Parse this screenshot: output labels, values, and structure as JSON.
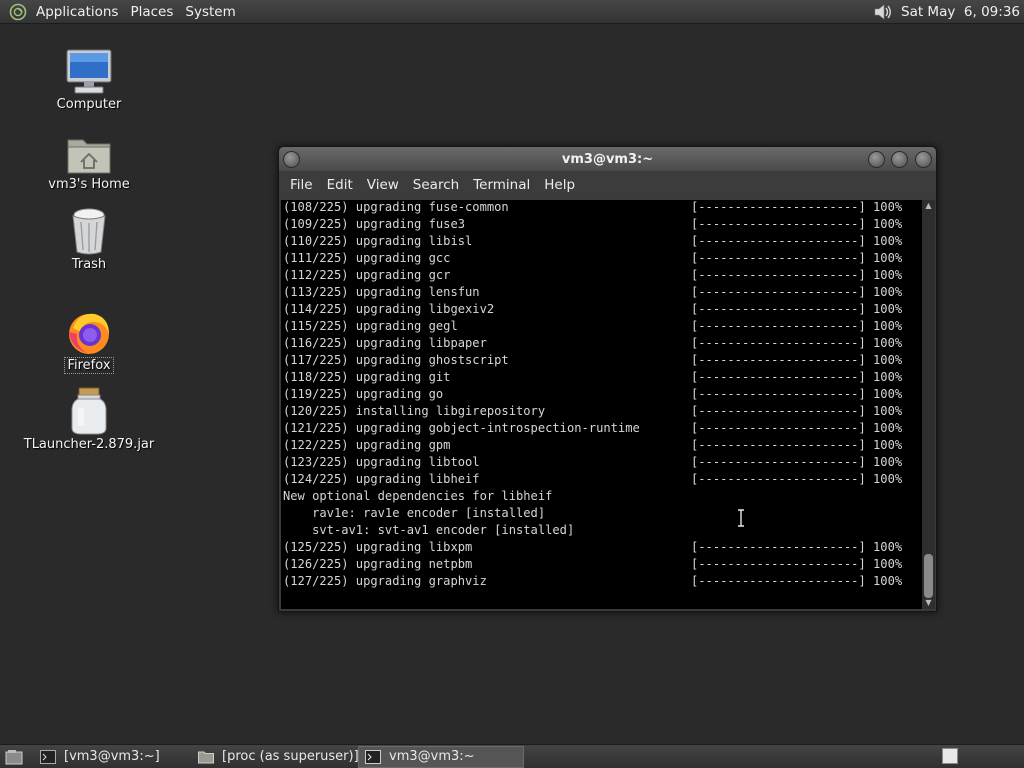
{
  "top_panel": {
    "menus": [
      "Applications",
      "Places",
      "System"
    ],
    "clock": "Sat May  6, 09:36"
  },
  "desktop_icons": [
    {
      "label": "Computer",
      "icon": "computer-icon"
    },
    {
      "label": "vm3's Home",
      "icon": "home-folder-icon"
    },
    {
      "label": "Trash",
      "icon": "trash-icon"
    },
    {
      "label": "Firefox",
      "icon": "firefox-icon"
    },
    {
      "label": "TLauncher-2.879.jar",
      "icon": "jar-file-icon"
    }
  ],
  "terminal": {
    "title": "vm3@vm3:~",
    "menu": [
      "File",
      "Edit",
      "View",
      "Search",
      "Terminal",
      "Help"
    ],
    "progress_bar": "[----------------------]",
    "lines": [
      {
        "text": "(108/225) upgrading fuse-common",
        "pct": "100%"
      },
      {
        "text": "(109/225) upgrading fuse3",
        "pct": "100%"
      },
      {
        "text": "(110/225) upgrading libisl",
        "pct": "100%"
      },
      {
        "text": "(111/225) upgrading gcc",
        "pct": "100%"
      },
      {
        "text": "(112/225) upgrading gcr",
        "pct": "100%"
      },
      {
        "text": "(113/225) upgrading lensfun",
        "pct": "100%"
      },
      {
        "text": "(114/225) upgrading libgexiv2",
        "pct": "100%"
      },
      {
        "text": "(115/225) upgrading gegl",
        "pct": "100%"
      },
      {
        "text": "(116/225) upgrading libpaper",
        "pct": "100%"
      },
      {
        "text": "(117/225) upgrading ghostscript",
        "pct": "100%"
      },
      {
        "text": "(118/225) upgrading git",
        "pct": "100%"
      },
      {
        "text": "(119/225) upgrading go",
        "pct": "100%"
      },
      {
        "text": "(120/225) installing libgirepository",
        "pct": "100%"
      },
      {
        "text": "(121/225) upgrading gobject-introspection-runtime",
        "pct": "100%"
      },
      {
        "text": "(122/225) upgrading gpm",
        "pct": "100%"
      },
      {
        "text": "(123/225) upgrading libtool",
        "pct": "100%"
      },
      {
        "text": "(124/225) upgrading libheif",
        "pct": "100%"
      },
      {
        "text": "New optional dependencies for libheif",
        "pct": null
      },
      {
        "text": "    rav1e: rav1e encoder [installed]",
        "pct": null
      },
      {
        "text": "    svt-av1: svt-av1 encoder [installed]",
        "pct": null
      },
      {
        "text": "(125/225) upgrading libxpm",
        "pct": "100%"
      },
      {
        "text": "(126/225) upgrading netpbm",
        "pct": "100%"
      },
      {
        "text": "(127/225) upgrading graphviz",
        "pct": "100%"
      }
    ]
  },
  "taskbar": {
    "tasks": [
      {
        "label": "[vm3@vm3:~]",
        "icon": "terminal-icon",
        "active": false
      },
      {
        "label": "[proc (as superuser)]",
        "icon": "folder-icon",
        "active": false
      },
      {
        "label": "vm3@vm3:~",
        "icon": "terminal-icon",
        "active": true
      }
    ]
  },
  "colors": {
    "desktop_bg": "#2a2a2a",
    "terminal_bg": "#000000",
    "terminal_fg": "#d6d6d6"
  }
}
